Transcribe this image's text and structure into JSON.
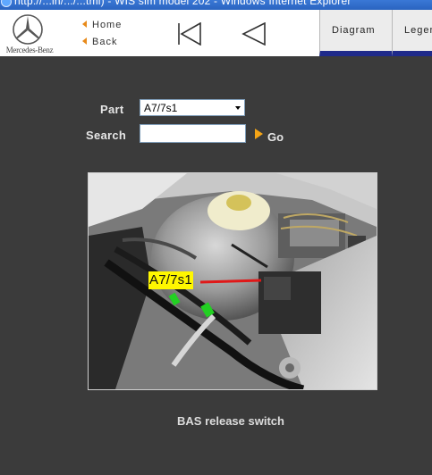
{
  "window": {
    "title": "http://...in/.../...tml) - WIS sim model 202 - Windows Internet Explorer"
  },
  "header": {
    "brand": "Mercedes-Benz",
    "nav": {
      "home": "Home",
      "back": "Back"
    },
    "tabs": {
      "diagram": "Diagram",
      "legend": "Legend"
    }
  },
  "form": {
    "part_label": "Part",
    "part_value": "A7/7s1",
    "search_label": "Search",
    "search_value": "",
    "go_label": "Go"
  },
  "photo": {
    "callout": "A7/7s1",
    "callout_color": "#fff700",
    "pointer_color": "#e01818"
  },
  "caption": "BAS release switch",
  "colors": {
    "page_background": "#3b3b3b",
    "header_background": "#ffffff",
    "tab_underline": "#1f2a8a",
    "nav_arrow": "#e88a1a",
    "go_arrow": "#f5a516"
  }
}
